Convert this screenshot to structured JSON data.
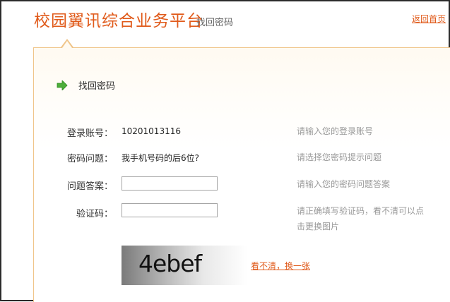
{
  "header": {
    "title": "校园翼讯综合业务平台",
    "subtitle": "找回密码",
    "home_link": "返回首页"
  },
  "section": {
    "title": "找回密码",
    "icon": "arrow-right-icon"
  },
  "form": {
    "account": {
      "label": "登录账号：",
      "value": "10201013116",
      "hint": "请输入您的登录账号"
    },
    "question": {
      "label": "密码问题：",
      "value": "我手机号码的后6位?",
      "hint": "请选择您密码提示问题"
    },
    "answer": {
      "label": "问题答案：",
      "value": "",
      "hint": "请输入您的密码问题答案"
    },
    "captcha": {
      "label": "验证码：",
      "value": "",
      "hint": "请正确填写验证码，看不清可以点击更换图片"
    }
  },
  "captcha_image": {
    "text": "4ebef"
  },
  "refresh_link": "看不清，换一张",
  "colors": {
    "brand": "#e05a1a",
    "accent": "#4cae3a",
    "border": "#f0c58a"
  }
}
